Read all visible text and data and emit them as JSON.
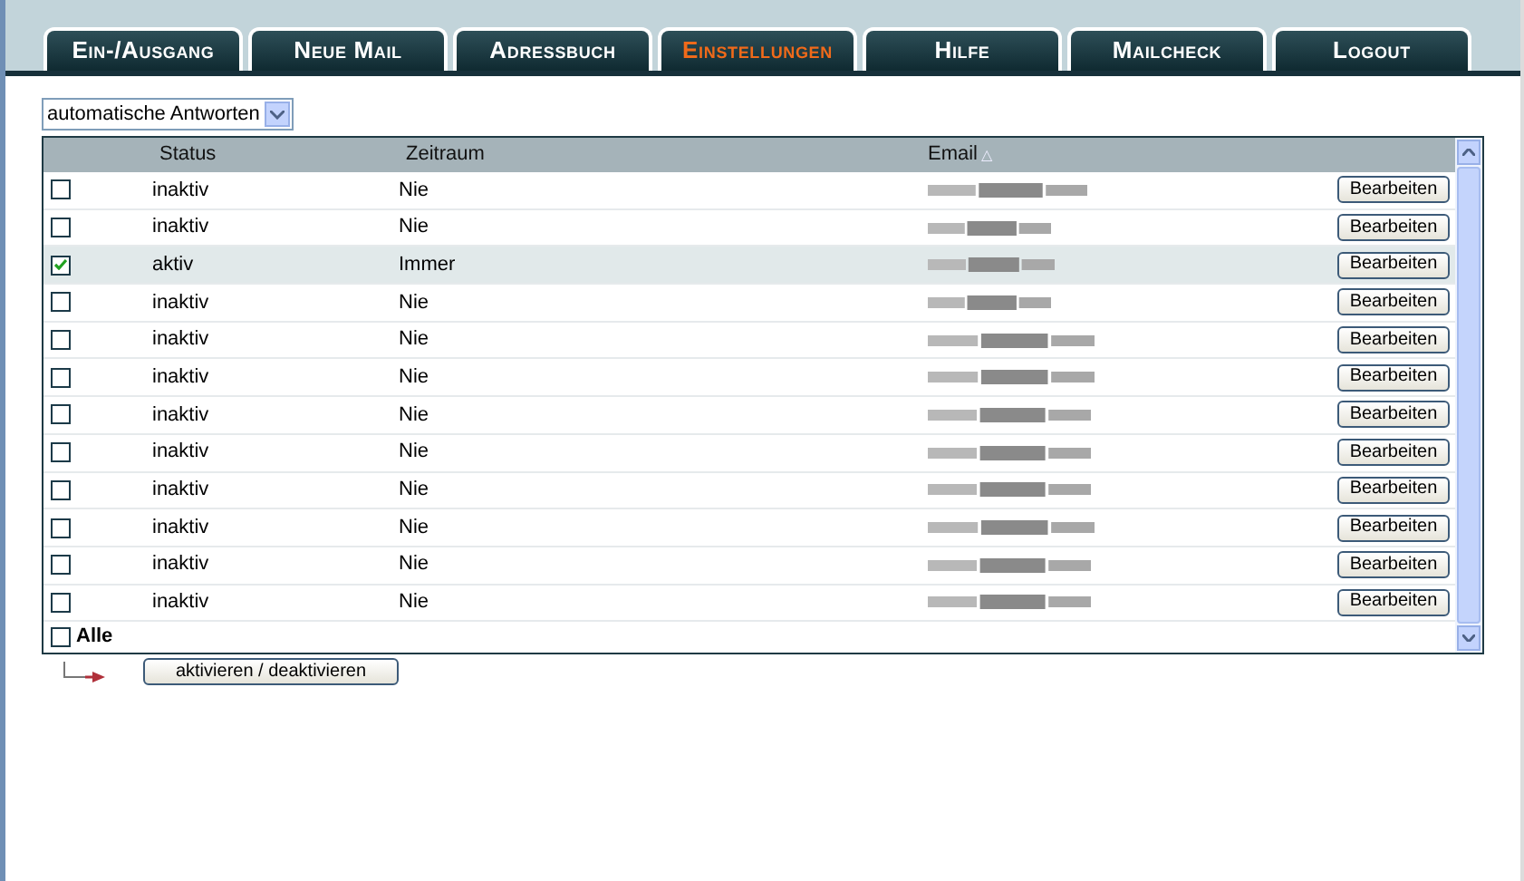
{
  "tabs": [
    {
      "label": "Ein-/Ausgang",
      "selected": false
    },
    {
      "label": "Neue Mail",
      "selected": false
    },
    {
      "label": "Adressbuch",
      "selected": false
    },
    {
      "label": "Einstellungen",
      "selected": true
    },
    {
      "label": "Hilfe",
      "selected": false
    },
    {
      "label": "Mailcheck",
      "selected": false
    },
    {
      "label": "Logout",
      "selected": false
    }
  ],
  "view_select": {
    "value": "automatische Antworten"
  },
  "table": {
    "columns": [
      "Status",
      "Zeitraum",
      "Email"
    ],
    "sort_indicator": "△",
    "rows": [
      {
        "checked": false,
        "status": "inaktiv",
        "period": "Nie",
        "action": "Bearbeiten"
      },
      {
        "checked": false,
        "status": "inaktiv",
        "period": "Nie",
        "action": "Bearbeiten"
      },
      {
        "checked": true,
        "status": "aktiv",
        "period": "Immer",
        "action": "Bearbeiten"
      },
      {
        "checked": false,
        "status": "inaktiv",
        "period": "Nie",
        "action": "Bearbeiten"
      },
      {
        "checked": false,
        "status": "inaktiv",
        "period": "Nie",
        "action": "Bearbeiten"
      },
      {
        "checked": false,
        "status": "inaktiv",
        "period": "Nie",
        "action": "Bearbeiten"
      },
      {
        "checked": false,
        "status": "inaktiv",
        "period": "Nie",
        "action": "Bearbeiten"
      },
      {
        "checked": false,
        "status": "inaktiv",
        "period": "Nie",
        "action": "Bearbeiten"
      },
      {
        "checked": false,
        "status": "inaktiv",
        "period": "Nie",
        "action": "Bearbeiten"
      },
      {
        "checked": false,
        "status": "inaktiv",
        "period": "Nie",
        "action": "Bearbeiten"
      },
      {
        "checked": false,
        "status": "inaktiv",
        "period": "Nie",
        "action": "Bearbeiten"
      },
      {
        "checked": false,
        "status": "inaktiv",
        "period": "Nie",
        "action": "Bearbeiten"
      }
    ],
    "select_all": {
      "label": "Alle",
      "checked": false
    }
  },
  "toggle_button": "aktivieren / deaktivieren"
}
